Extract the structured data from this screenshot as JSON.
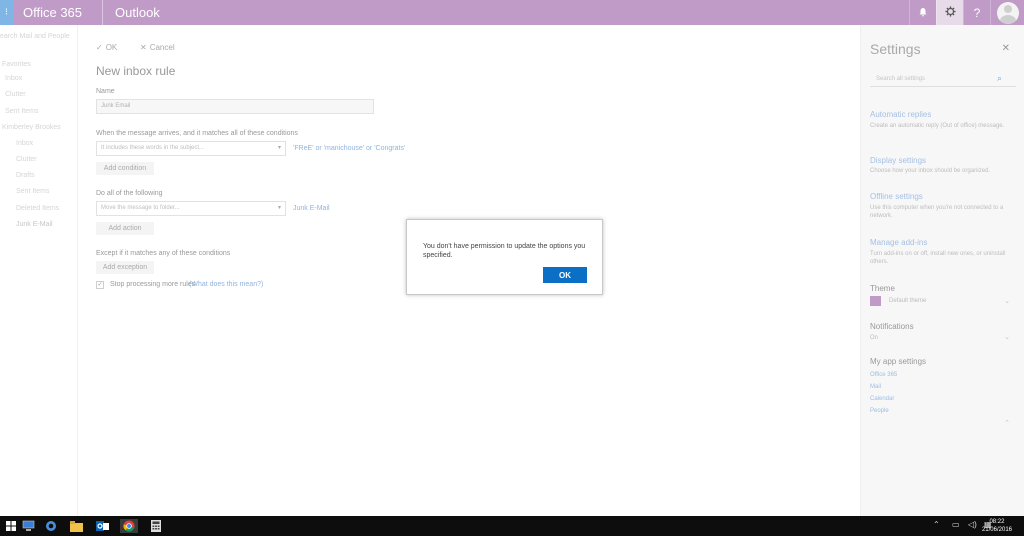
{
  "topbar": {
    "brand": "Office 365",
    "app": "Outlook",
    "bell": "bell-icon",
    "gear": "gear-icon",
    "help": "?"
  },
  "leftnav": {
    "header": "earch Mail and People",
    "favorites": "Favorites",
    "inbox": "Inbox",
    "clutter": "Clutter",
    "sent": "Sent Items",
    "account": "Kimberley Brookes",
    "folders": [
      "Inbox",
      "Clutter",
      "Drafts",
      "Sent Items",
      "Deleted Items",
      "Junk E-Mail"
    ]
  },
  "main": {
    "ok": "OK",
    "cancel": "Cancel",
    "title": "New inbox rule",
    "name_label": "Name",
    "name_value": "Junk Email",
    "condition_label": "When the message arrives, and it matches all of these conditions",
    "condition_select": "It includes these words in the subject...",
    "condition_value": "'FReE' or 'manichouse' or 'Congrats'",
    "add_condition": "Add condition",
    "action_label": "Do all of the following",
    "action_select": "Move the message to folder...",
    "action_value": "Junk E-Mail",
    "add_action": "Add action",
    "exception_label": "Except if it matches any of these conditions",
    "add_exception": "Add exception",
    "stop_processing": "Stop processing more rules",
    "what_means": "(What does this mean?)"
  },
  "settings": {
    "title": "Settings",
    "search_placeholder": "Search all settings",
    "auto_replies": "Automatic replies",
    "auto_replies_desc": "Create an automatic reply (Out of office) message.",
    "display": "Display settings",
    "display_desc": "Choose how your inbox should be organized.",
    "offline": "Offline settings",
    "offline_desc": "Use this computer when you're not connected to a network.",
    "addins": "Manage add-ins",
    "addins_desc": "Turn add-ins on or off, install new ones, or uninstall others.",
    "theme": "Theme",
    "theme_value": "Default theme",
    "notifications": "Notifications",
    "notifications_value": "On",
    "my_app": "My app settings",
    "apps": [
      "Office 365",
      "Mail",
      "Calendar",
      "People"
    ]
  },
  "dialog": {
    "message": "You don't have permission to update the options you specified.",
    "ok": "OK"
  },
  "taskbar": {
    "time": "08:22",
    "date": "21/06/2016"
  },
  "colors": {
    "topbar": "#c09bc7",
    "ok_button": "#0b6fc5"
  }
}
